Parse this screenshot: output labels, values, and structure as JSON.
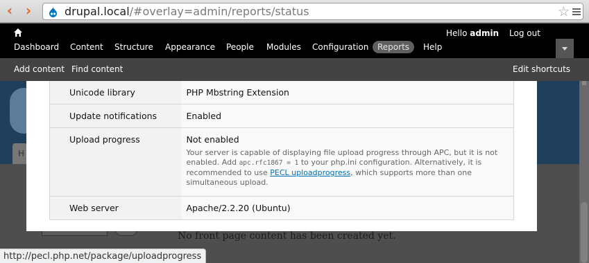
{
  "browser": {
    "url_host": "drupal.local",
    "url_path": "/#overlay=admin/reports/status",
    "back_icon": "chevron-left-icon",
    "forward_icon": "chevron-right-icon"
  },
  "toolbar": {
    "greeting": "Hello",
    "username": "admin",
    "logout": "Log out",
    "menu": [
      {
        "label": "Dashboard"
      },
      {
        "label": "Content"
      },
      {
        "label": "Structure"
      },
      {
        "label": "Appearance"
      },
      {
        "label": "People"
      },
      {
        "label": "Modules"
      },
      {
        "label": "Configuration"
      },
      {
        "label": "Reports",
        "active": true
      },
      {
        "label": "Help"
      }
    ]
  },
  "shortcuts": {
    "add_content": "Add content",
    "find_content": "Find content",
    "edit_shortcuts": "Edit shortcuts"
  },
  "status_rows": [
    {
      "label": "Unicode library",
      "value": "PHP Mbstring Extension"
    },
    {
      "label": "Update notifications",
      "value": "Enabled"
    },
    {
      "label": "Upload progress",
      "value": "Not enabled",
      "desc_1": "Your server is capable of displaying file upload progress through APC, but it is not enabled. Add ",
      "desc_code": "apc.rfc1867 = 1",
      "desc_2": " to your php.ini configuration. Alternatively, it is recommended to use ",
      "desc_link": "PECL uploadprogress",
      "desc_3": ", which supports more than one simultaneous upload."
    },
    {
      "label": "Web server",
      "value": "Apache/2.2.20 (Ubuntu)"
    }
  ],
  "background": {
    "tab_label": "H",
    "empty_text": "No front page content has been created yet."
  },
  "statusbar": {
    "link_url": "http://pecl.php.net/package/uploadprogress"
  },
  "colors": {
    "accent_orange": "#e8661e",
    "link_blue": "#0071b3"
  }
}
